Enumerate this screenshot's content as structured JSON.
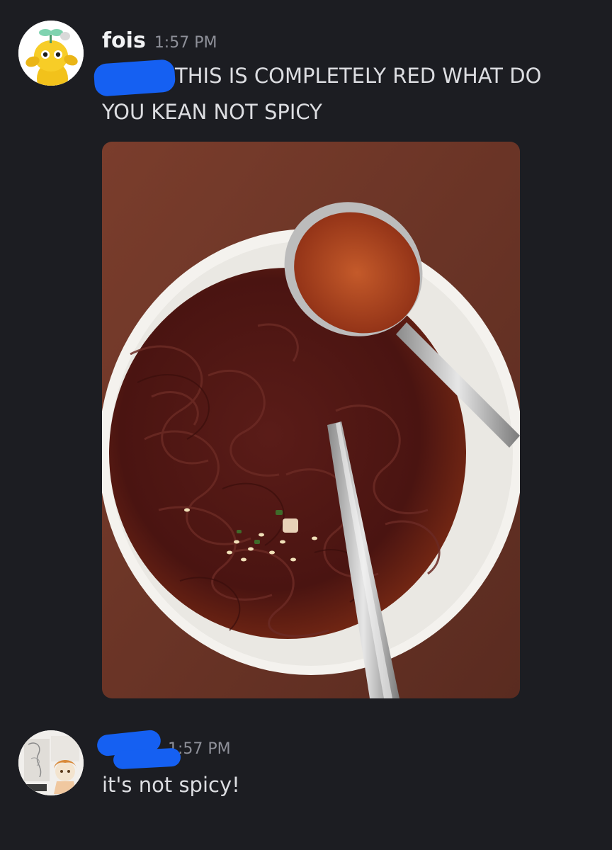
{
  "messages": [
    {
      "username": "fois",
      "timestamp": "1:57 PM",
      "text_line1": "THIS IS COMPLETELY RED WHAT DO",
      "text_line2": "YOU KEAN NOT SPICY",
      "avatar": "yellow-creature-avatar",
      "attachment": "photo of noodles in red broth with spoon and chopsticks"
    },
    {
      "username": "",
      "timestamp": "1:57 PM",
      "text": "it's not spicy!",
      "avatar": "sketch-art-avatar"
    }
  ],
  "colors": {
    "background": "#1c1d22",
    "redaction": "#1560f2",
    "username": "#f2f3f5",
    "timestamp": "#8e9099",
    "text": "#dcdde1"
  }
}
